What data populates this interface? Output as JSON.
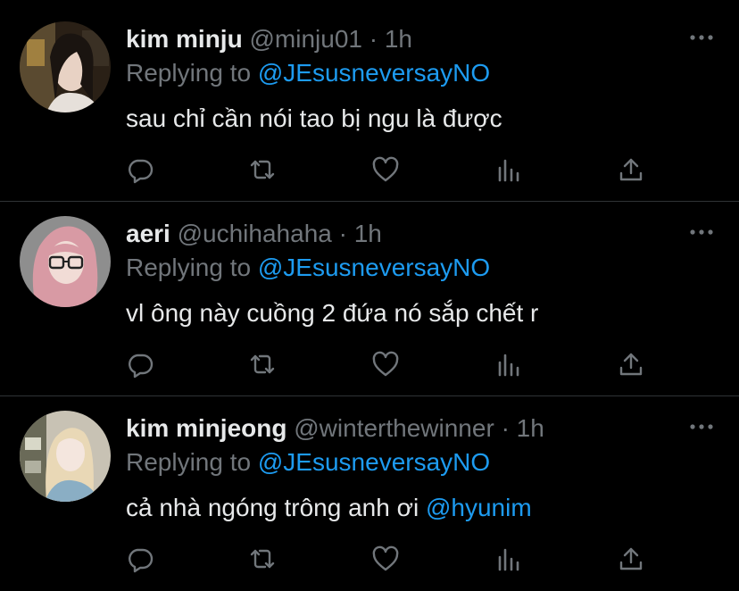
{
  "colors": {
    "background": "#000000",
    "text_primary": "#e7e9ea",
    "text_secondary": "#71767b",
    "accent": "#1d9bf0",
    "divider": "#2f3336"
  },
  "actions_icons": [
    "reply-icon",
    "retweet-icon",
    "like-icon",
    "analytics-icon",
    "share-icon"
  ],
  "tweets": [
    {
      "name": "kim minju",
      "handle": "@minju01",
      "sep": "·",
      "time": "1h",
      "replying_prefix": "Replying to",
      "replying_to": "@JEsusneversayNO",
      "text": "sau chỉ cần nói tao bị ngu là được",
      "text_mention": ""
    },
    {
      "name": "aeri",
      "handle": "@uchihahaha",
      "sep": "·",
      "time": "1h",
      "replying_prefix": "Replying to",
      "replying_to": "@JEsusneversayNO",
      "text": "vl ông này cuồng 2 đứa nó sắp chết r",
      "text_mention": ""
    },
    {
      "name": "kim minjeong",
      "handle": "@winterthewinner",
      "sep": "·",
      "time": "1h",
      "replying_prefix": "Replying to",
      "replying_to": "@JEsusneversayNO",
      "text": "cả nhà ngóng trông anh ơi ",
      "text_mention": "@hyunim"
    }
  ]
}
